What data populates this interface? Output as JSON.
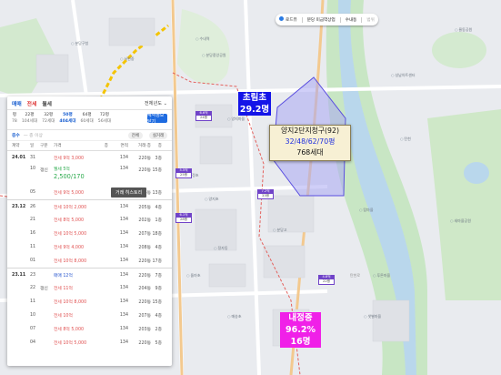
{
  "map": {
    "controls": {
      "checked_label": "로드뷰",
      "item2": "분당 미금역상업",
      "item3": "수내동",
      "item4": "범위"
    },
    "schools": [
      {
        "name": "초림초",
        "value": "29.2명",
        "color": "#1414e8"
      },
      {
        "name": "내정중",
        "value": "96.2%",
        "value2": "16명",
        "color": "#f020e8"
      }
    ],
    "complex": {
      "name": "양지2단지청구(92)",
      "sizes": "32/48/62/70평",
      "households": "768세대"
    },
    "price_tags": [
      {
        "top": "6.6억",
        "bottom": "24평"
      },
      {
        "top": "5.5억",
        "bottom": "25평"
      },
      {
        "top": "7.2억",
        "bottom": "33평"
      },
      {
        "top": "4.8억",
        "bottom": "22평"
      },
      {
        "top": "6.1억",
        "bottom": "28평"
      }
    ],
    "places": [
      "분당구청",
      "서현중",
      "분당중앙공원",
      "양지마을",
      "내정초",
      "수내역",
      "분당고",
      "성남아트센터",
      "정자동",
      "탑마을",
      "양지초",
      "푸른마을",
      "돌마초",
      "샛별마을",
      "새마을공원",
      "매송초",
      "탄천",
      "율동공원"
    ],
    "road_label": "탄천로"
  },
  "panel": {
    "tabs": [
      {
        "label": "매매",
        "style": "blue2"
      },
      {
        "label": "전세",
        "style": "red"
      },
      {
        "label": "월세",
        "style": "normal"
      }
    ],
    "year_select": "전체년도 ⌄",
    "sizes": [
      {
        "pyeong": "평",
        "m2": "78",
        "units": "㎡"
      },
      {
        "pyeong": "22평",
        "m2": "104세대",
        "units": ""
      },
      {
        "pyeong": "32평",
        "m2": "72세대",
        "units": ""
      },
      {
        "pyeong": "50평",
        "m2": "404세대",
        "units": "",
        "active": true
      },
      {
        "pyeong": "64평",
        "m2": "60세대",
        "units": ""
      },
      {
        "pyeong": "72평",
        "m2": "56세대",
        "units": ""
      }
    ],
    "close_button": "계약정보 닫기",
    "filter_label": "층수",
    "filter_hint": "— 층 이상",
    "filter_pills": [
      "전체",
      "실거래"
    ],
    "headers": [
      "계약",
      "일",
      "구분",
      "가격",
      "층",
      "면적",
      "거래·층",
      "층"
    ],
    "rows": [
      {
        "date": "24.01",
        "day": "31",
        "type": "",
        "price": "전세 9억 3,000",
        "color": "red",
        "floor": "",
        "area": "134",
        "unit": "220동",
        "fl": "3층",
        "divider": true
      },
      {
        "date": "",
        "day": "10",
        "type": "갱신",
        "price": "월세 5억",
        "price2": "2,500/170",
        "color": "green",
        "floor": "",
        "area": "134",
        "unit": "220동",
        "fl": "15층",
        "tall": true
      },
      {
        "date": "",
        "day": "05",
        "type": "",
        "price": "전세 9억 5,000",
        "color": "red",
        "floor": "",
        "area": "134",
        "unit": "206동",
        "fl": "13층"
      },
      {
        "date": "23.12",
        "day": "26",
        "type": "",
        "price": "전세 10억 2,000",
        "color": "red",
        "floor": "",
        "area": "134",
        "unit": "205동",
        "fl": "4층",
        "divider": true
      },
      {
        "date": "",
        "day": "21",
        "type": "",
        "price": "전세 8억 5,000",
        "color": "red",
        "floor": "",
        "area": "134",
        "unit": "202동",
        "fl": "1층"
      },
      {
        "date": "",
        "day": "16",
        "type": "",
        "price": "전세 10억 5,000",
        "color": "red",
        "floor": "",
        "area": "134",
        "unit": "207동",
        "fl": "18층"
      },
      {
        "date": "",
        "day": "11",
        "type": "",
        "price": "전세 9억 4,000",
        "color": "red",
        "floor": "",
        "area": "134",
        "unit": "208동",
        "fl": "4층"
      },
      {
        "date": "",
        "day": "01",
        "type": "",
        "price": "전세 10억 8,000",
        "color": "red",
        "floor": "",
        "area": "134",
        "unit": "220동",
        "fl": "17층"
      },
      {
        "date": "23.11",
        "day": "23",
        "type": "",
        "price": "매매 12억",
        "color": "blue",
        "floor": "",
        "area": "134",
        "unit": "220동",
        "fl": "7층",
        "divider": true
      },
      {
        "date": "",
        "day": "22",
        "type": "갱신",
        "price": "전세 11억",
        "color": "red",
        "floor": "",
        "area": "134",
        "unit": "204동",
        "fl": "9층"
      },
      {
        "date": "",
        "day": "11",
        "type": "",
        "price": "전세 10억 8,000",
        "color": "red",
        "floor": "",
        "area": "134",
        "unit": "220동",
        "fl": "15층"
      },
      {
        "date": "",
        "day": "10",
        "type": "",
        "price": "전세 10억",
        "color": "red",
        "floor": "",
        "area": "134",
        "unit": "207동",
        "fl": "4층"
      },
      {
        "date": "",
        "day": "07",
        "type": "",
        "price": "전세 8억 5,000",
        "color": "red",
        "floor": "",
        "area": "134",
        "unit": "203동",
        "fl": "2층"
      },
      {
        "date": "",
        "day": "04",
        "type": "",
        "price": "전세 10억 5,000",
        "color": "red",
        "floor": "",
        "area": "134",
        "unit": "220동",
        "fl": "5층"
      }
    ],
    "tooltip": "거래 히스토리"
  }
}
